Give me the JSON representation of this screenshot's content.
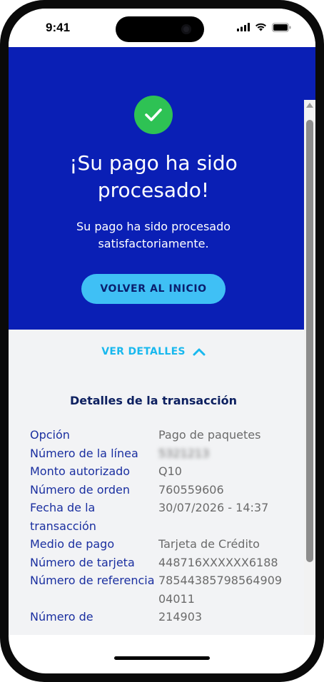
{
  "status_bar": {
    "time": "9:41"
  },
  "hero": {
    "title": "¡Su pago ha sido procesado!",
    "subtitle": "Su pago ha sido procesado satisfactoriamente.",
    "home_button": "VOLVER AL INICIO",
    "accent_color": "#0a1fb5",
    "success_color": "#2ec254"
  },
  "details": {
    "toggle_label": "VER DETALLES",
    "heading": "Detalles de la transacción",
    "rows": [
      {
        "label": "Opción",
        "value": "Pago de paquetes"
      },
      {
        "label": "Número de la línea",
        "value": "5321213"
      },
      {
        "label": "Monto autorizado",
        "value": "Q10"
      },
      {
        "label": "Número de orden",
        "value": "760559606"
      },
      {
        "label": "Fecha de la transacción",
        "value": "30/07/2026 - 14:37"
      },
      {
        "label": "Medio de pago",
        "value": "Tarjeta de Crédito"
      },
      {
        "label": "Número de tarjeta",
        "value": "448716XXXXXX6188"
      },
      {
        "label": "Número de referencia",
        "value": "7854438579856490904011"
      },
      {
        "label": "Número de",
        "value": "214903"
      }
    ]
  }
}
